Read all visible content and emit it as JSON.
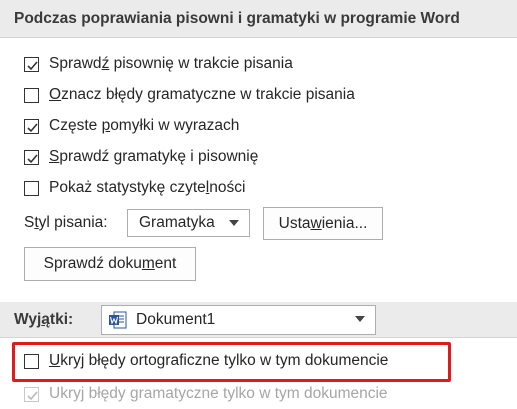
{
  "section1": {
    "title": "Podczas poprawiania pisowni i gramatyki w programie Word"
  },
  "options": [
    {
      "pre": "Sprawd",
      "key": "ź",
      "post": " pisownię w trakcie pisania",
      "checked": true
    },
    {
      "pre": "",
      "key": "O",
      "post": "znacz błędy gramatyczne w trakcie pisania",
      "checked": false
    },
    {
      "pre": "Częste ",
      "key": "p",
      "post": "omyłki w wyrazach",
      "checked": true
    },
    {
      "pre": "",
      "key": "S",
      "post": "prawdź gramatykę i pisownię",
      "checked": true
    },
    {
      "pre": "Pokaż statystykę czyte",
      "key": "l",
      "post": "ności",
      "checked": false
    }
  ],
  "writing_style": {
    "label_pre": "S",
    "label_key": "t",
    "label_post": "yl pisania:",
    "value": "Gramatyka"
  },
  "buttons": {
    "settings_pre": "Usta",
    "settings_key": "w",
    "settings_post": "ienia...",
    "check_pre": "Sprawdź doku",
    "check_key": "m",
    "check_post": "ent"
  },
  "section2": {
    "label_pre": "Wyj",
    "label_key": "ą",
    "label_post": "tki:",
    "document": "Dokument1"
  },
  "exceptions": [
    {
      "pre": "",
      "key": "U",
      "post": "kryj błędy ortograficzne tylko w tym dokumencie",
      "checked": false,
      "disabled": false
    },
    {
      "pre": "Ukryj błędy ",
      "key": "g",
      "post": "ramatyczne tylko w tym dokumencie",
      "checked": true,
      "disabled": true
    }
  ],
  "colors": {
    "highlight": "#e01b1b",
    "header_bg": "#ebebeb",
    "word_icon": "#2b579a"
  }
}
